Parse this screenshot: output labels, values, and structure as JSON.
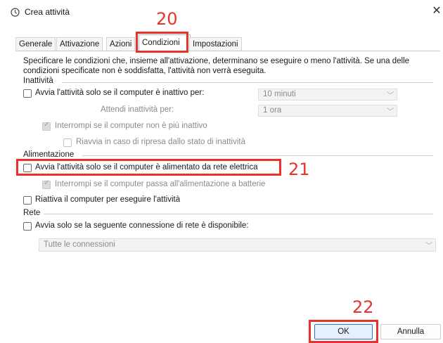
{
  "window": {
    "title": "Crea attività",
    "close_glyph": "✕",
    "icon": "clock-icon"
  },
  "tabs": [
    {
      "label": "Generale"
    },
    {
      "label": "Attivazione"
    },
    {
      "label": "Azioni"
    },
    {
      "label": "Condizioni",
      "active": true
    },
    {
      "label": "Impostazioni"
    }
  ],
  "intro": {
    "line1": "Specificare le condizioni che, insieme all'attivazione, determinano se eseguire o meno l'attività. Se una delle",
    "line2": "condizioni specificate non è soddisfatta, l'attività non verrà eseguita."
  },
  "inattivita": {
    "section_label": "Inattività",
    "start_if_idle_label": "Avvia l'attività solo se il computer è inattivo per:",
    "idle_duration": "10 minuti",
    "wait_label": "Attendi inattività per:",
    "wait_duration": "1 ora",
    "stop_if_not_idle_label": "Interrompi se il computer non è più inattivo",
    "restart_label": "Riavvia in caso di ripresa dallo stato di inattività"
  },
  "alimentazione": {
    "section_label": "Alimentazione",
    "ac_power_label": "Avvia l'attività solo se il computer è alimentato da rete elettrica",
    "stop_on_battery_label": "Interrompi se il computer passa all'alimentazione a batterie",
    "wake_label": "Riattiva il computer per eseguire l'attività"
  },
  "rete": {
    "section_label": "Rete",
    "network_label": "Avvia solo se la seguente connessione di rete è disponibile:",
    "network_value": "Tutte le connessioni"
  },
  "buttons": {
    "ok": "OK",
    "cancel": "Annulla"
  },
  "annotations": {
    "tab_marker": "20",
    "power_marker": "21",
    "ok_marker": "22",
    "color": "#e8332c"
  }
}
